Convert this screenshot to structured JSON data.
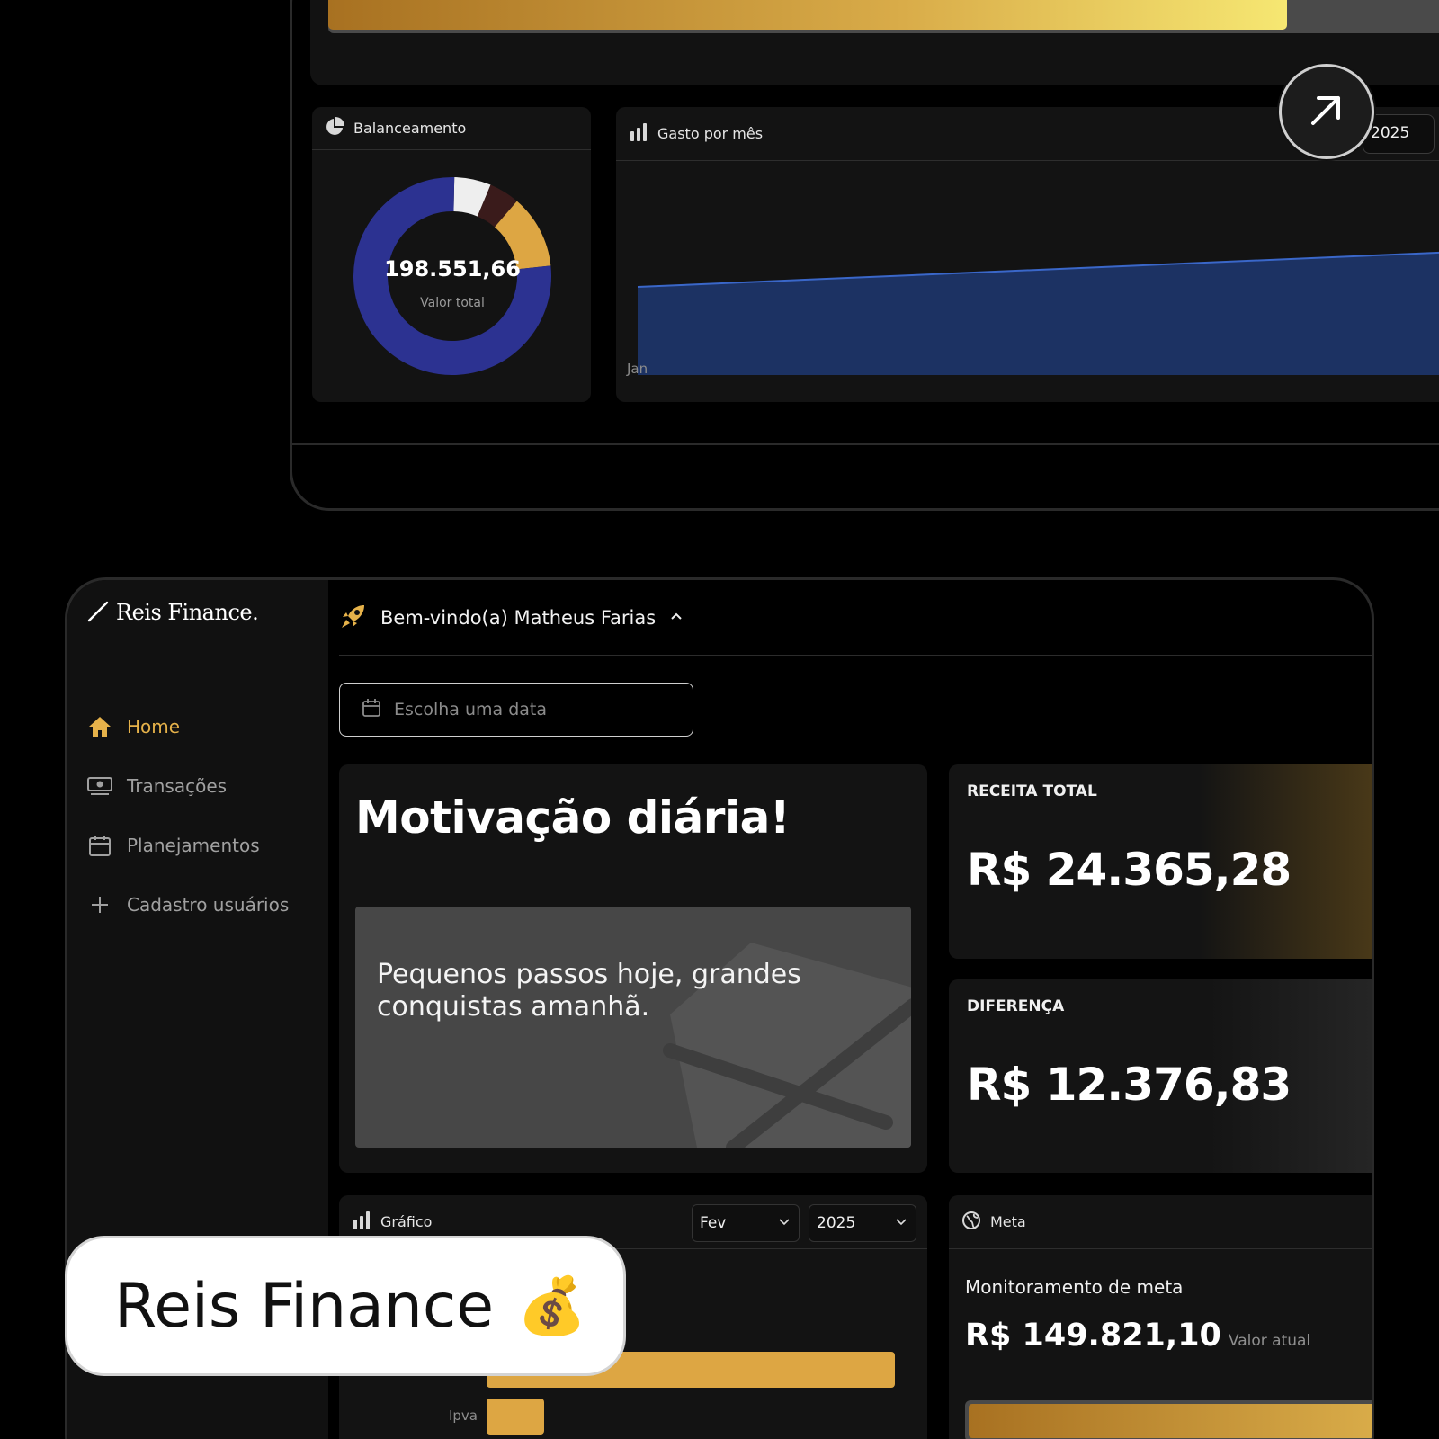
{
  "colors": {
    "accent_gold": "#dda643",
    "donut_navy": "#2c3291",
    "donut_white": "#eeeeee",
    "donut_maroon": "#3a1b1b",
    "donut_gold": "#dda643",
    "area_fill": "#1c3263",
    "area_line": "#3a67c9"
  },
  "back_window": {
    "top_progress_fraction": 0.82,
    "balance": {
      "title": "Balanceamento",
      "icon": "pie-chart-icon",
      "total_value": "198.551,66",
      "total_label": "Valor total"
    },
    "spending": {
      "title": "Gasto por mês",
      "icon": "bar-chart-icon",
      "year": "2025",
      "x_label_first": "Jan"
    },
    "expand_icon": "arrow-up-right-icon"
  },
  "front_window": {
    "logo_text": "Reis Finance.",
    "nav": [
      {
        "label": "Home",
        "icon": "home-icon",
        "active": true
      },
      {
        "label": "Transações",
        "icon": "cash-icon",
        "active": false
      },
      {
        "label": "Planejamentos",
        "icon": "calendar-icon",
        "active": false
      },
      {
        "label": "Cadastro usuários",
        "icon": "plus-icon",
        "active": false
      }
    ],
    "welcome": "Bem-vindo(a) Matheus Farias",
    "date_placeholder": "Escolha uma data",
    "motivation": {
      "title": "Motivação diária!",
      "quote": "Pequenos passos hoje, grandes conquistas amanhã."
    },
    "revenue": {
      "label": "RECEITA TOTAL",
      "value": "R$ 24.365,28"
    },
    "difference": {
      "label": "DIFERENÇA",
      "value": "R$ 12.376,83"
    },
    "grafico": {
      "title": "Gráfico",
      "month": "Fev",
      "year": "2025",
      "visible_bar_label": "Ipva"
    },
    "meta": {
      "title": "Meta",
      "icon": "globe-icon",
      "subtitle": "Monitoramento de meta",
      "value": "R$ 149.821,10",
      "value_note": "Valor atual",
      "progress_fraction": 1.0
    }
  },
  "brand_label": {
    "text": "Reis Finance",
    "emoji": "💰"
  },
  "chart_data": [
    {
      "type": "pie",
      "title": "Balanceamento",
      "slices_fraction": [
        0.06,
        0.05,
        0.12,
        0.77
      ],
      "slice_colors": [
        "#eeeeee",
        "#3a1b1b",
        "#dda643",
        "#2c3291"
      ],
      "center_value": "198.551,66",
      "center_label": "Valor total"
    },
    {
      "type": "area",
      "title": "Gasto por mês",
      "categories": [
        "Jan"
      ],
      "note": "rising area, only first month label visible"
    },
    {
      "type": "bar",
      "title": "Gráfico",
      "orientation": "horizontal",
      "categories": [
        "",
        "Ipva"
      ],
      "values_relative": [
        1.0,
        0.14
      ]
    }
  ]
}
